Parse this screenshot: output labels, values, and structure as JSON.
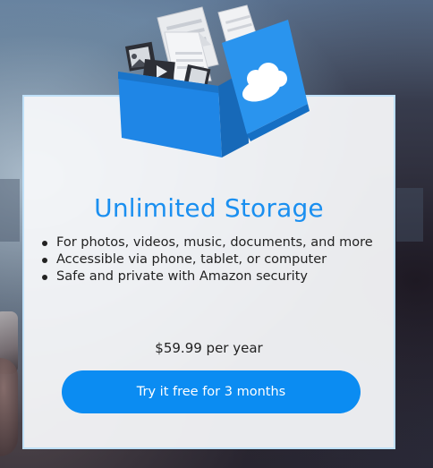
{
  "card": {
    "title": "Unlimited Storage",
    "features": [
      "For photos, videos, music, documents, and more",
      "Accessible via phone, tablet, or computer",
      "Safe and private with Amazon security"
    ],
    "price": "$59.99 per year",
    "cta_label": "Try it free for 3 months"
  },
  "illustration": {
    "name": "storage-box-icon"
  },
  "colors": {
    "accent": "#1a8ff0",
    "button": "#0b8cf2",
    "box": "#1f86e6",
    "card_border": "#bfe0f8"
  }
}
